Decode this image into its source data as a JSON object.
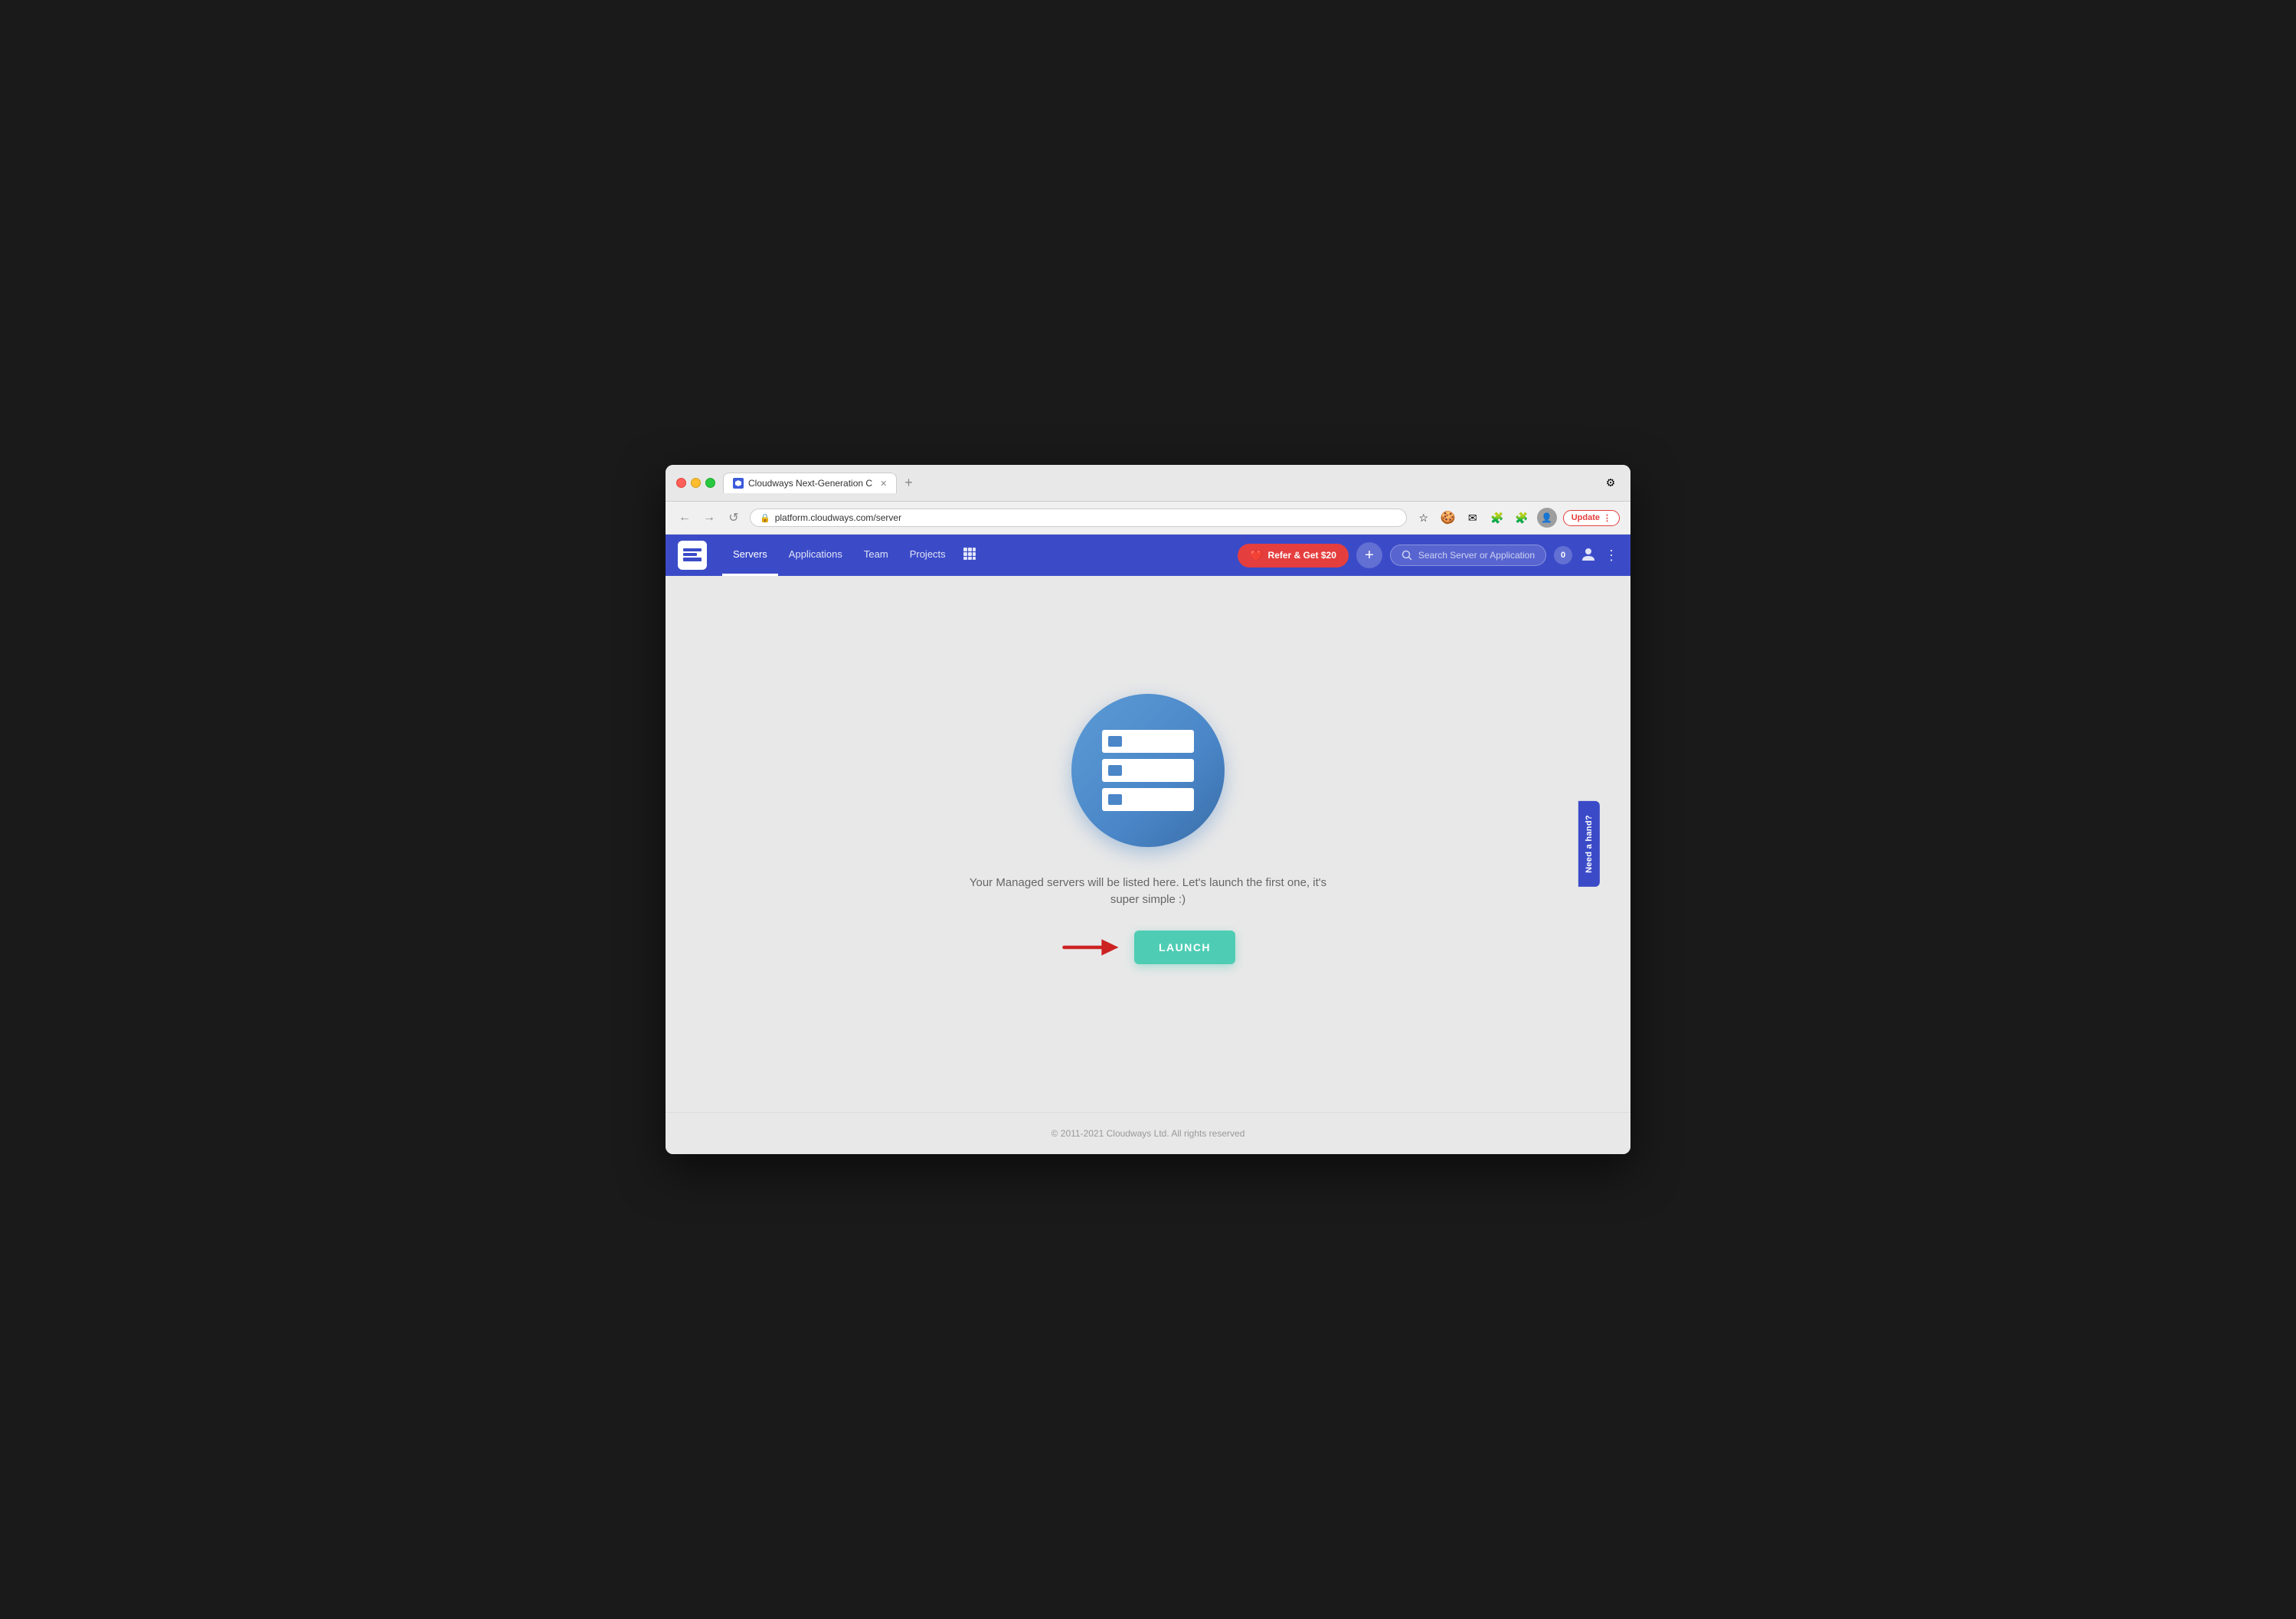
{
  "browser": {
    "tab_title": "Cloudways Next-Generation C",
    "url": "platform.cloudways.com/server",
    "new_tab_label": "+",
    "nav": {
      "back": "←",
      "forward": "→",
      "reload": "↺"
    },
    "actions": {
      "bookmark": "☆",
      "update_label": "Update",
      "more": "⋮"
    }
  },
  "navbar": {
    "logo_alt": "Cloudways",
    "links": [
      {
        "label": "Servers",
        "active": true
      },
      {
        "label": "Applications",
        "active": false
      },
      {
        "label": "Team",
        "active": false
      },
      {
        "label": "Projects",
        "active": false
      }
    ],
    "refer_label": "Refer & Get $20",
    "add_label": "+",
    "search_placeholder": "Search Server or Application",
    "notification_count": "0",
    "more": "⋮"
  },
  "main": {
    "empty_message": "Your Managed servers will be listed here. Let's launch the first one, it's super simple :)",
    "launch_label": "LAUNCH"
  },
  "sidebar": {
    "help_label": "Need a hand?"
  },
  "footer": {
    "copyright": "© 2011-2021 Cloudways Ltd. All rights reserved"
  }
}
